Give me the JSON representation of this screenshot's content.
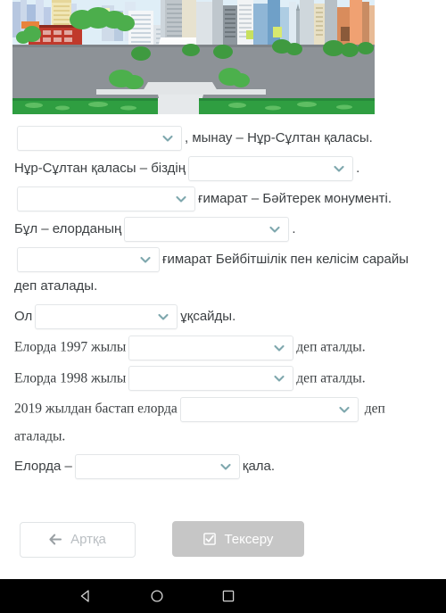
{
  "illustration": {
    "alt_name": "nur-sultan-city-illustration",
    "colors": {
      "sky": "#cfe3ef",
      "road": "#8d9297",
      "grass": "#2f9e41",
      "monument": "#e9ebec",
      "tree": "#55b84f"
    }
  },
  "exercise": {
    "rows": [
      {
        "id": "row-1",
        "before": "",
        "after": ", мынау – Нұр-Сұлтан қаласы.",
        "select_value": "",
        "select_width": "w-lg"
      },
      {
        "id": "row-2",
        "before": "Нұр-Сұлтан қаласы – біздің",
        "after": ".",
        "select_value": "",
        "select_width": "w-lg"
      },
      {
        "id": "row-3",
        "before": "",
        "after": "ғимарат – Бәйтерек монументі.",
        "select_value": "",
        "select_width": "w-xl"
      },
      {
        "id": "row-4",
        "before": "Бұл – елорданың",
        "after": ".",
        "select_value": "",
        "select_width": "w-lg"
      },
      {
        "id": "row-5",
        "before": "",
        "after": "ғимарат Бейбітшілік пен келісім сарайы деп аталады.",
        "select_value": "",
        "select_width": "w-md"
      },
      {
        "id": "row-6",
        "before": "Ол",
        "after": "ұқсайды.",
        "select_value": "",
        "select_width": "w-md"
      },
      {
        "id": "row-7",
        "before": "Елорда 1997 жылы",
        "after": "деп аталды.",
        "select_value": "",
        "select_width": "w-lg",
        "serif": true
      },
      {
        "id": "row-8",
        "before": "Елорда 1998 жылы",
        "after": "деп аталды.",
        "select_value": "",
        "select_width": "w-lg",
        "serif": true
      },
      {
        "id": "row-9",
        "before": "2019 жылдан бастап елорда",
        "after": " деп аталады.",
        "select_value": "",
        "select_width": "w-xl",
        "serif": true
      },
      {
        "id": "row-10",
        "before": "Елорда –",
        "after": "қала.",
        "select_value": "",
        "select_width": "w-lg"
      }
    ]
  },
  "buttons": {
    "back_label": "Артқа",
    "back_icon": "arrow-left-icon",
    "check_label": "Тексеру",
    "check_icon": "checkbox-checked-icon"
  },
  "navbar": {
    "back": "back-triangle-icon",
    "home": "home-circle-icon",
    "recents": "recents-square-icon"
  },
  "theme": {
    "chevron_color": "#7ea7ad",
    "text_color": "#3c4043",
    "select_border": "#e3e6e8",
    "check_button_bg": "#c6c6c6",
    "back_button_text": "#b9bec2",
    "navbar_bg": "#000000"
  }
}
